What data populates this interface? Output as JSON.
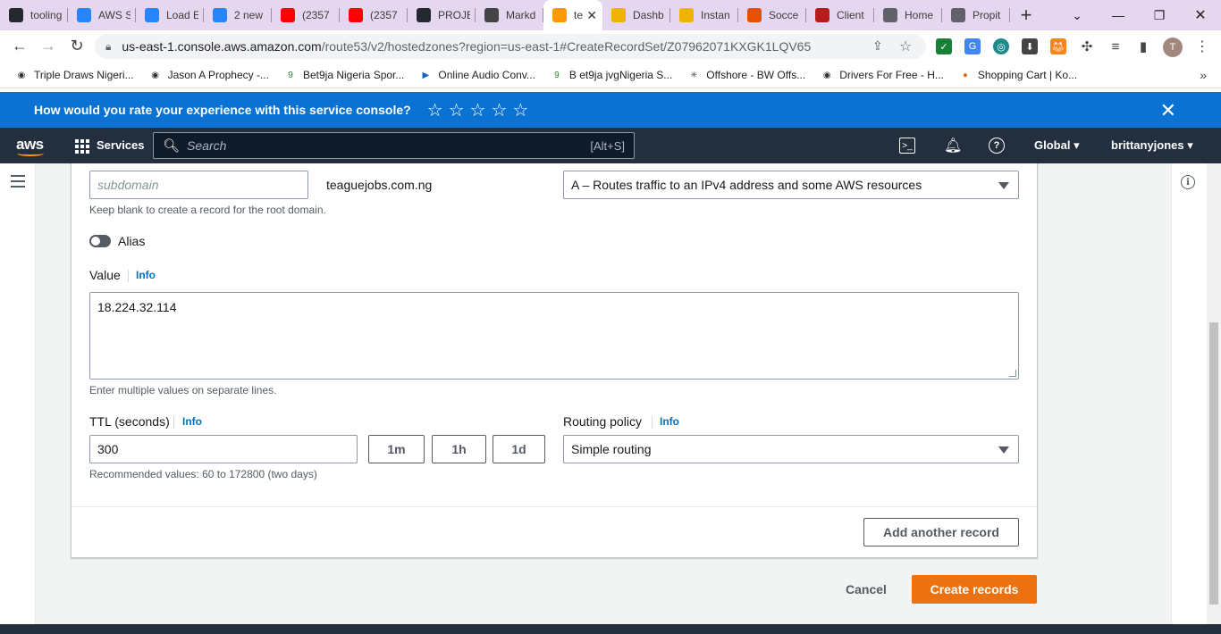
{
  "browser": {
    "tabs": [
      {
        "label": "tooling",
        "icon": "github-icon",
        "color": "#24292f"
      },
      {
        "label": "AWS S",
        "icon": "jira-icon",
        "color": "#2684ff"
      },
      {
        "label": "Load E",
        "icon": "jira-icon",
        "color": "#2684ff"
      },
      {
        "label": "2 new",
        "icon": "jira-icon",
        "color": "#2684ff"
      },
      {
        "label": "(2357",
        "icon": "youtube-icon",
        "color": "#ff0000"
      },
      {
        "label": "(2357",
        "icon": "youtube-icon",
        "color": "#ff0000"
      },
      {
        "label": "PROJE",
        "icon": "github-icon",
        "color": "#24292f"
      },
      {
        "label": "Markd",
        "icon": "markdown-icon",
        "color": "#444444"
      },
      {
        "label": "te",
        "icon": "aws-cube-icon",
        "color": "#ff9900",
        "active": true
      },
      {
        "label": "Dashb",
        "icon": "aws-box-icon",
        "color": "#f0b400"
      },
      {
        "label": "Instan",
        "icon": "aws-box-icon",
        "color": "#f0b400"
      },
      {
        "label": "Socce",
        "icon": "ls-icon",
        "color": "#e65100"
      },
      {
        "label": "Client",
        "icon": "crown-icon",
        "color": "#b71c1c"
      },
      {
        "label": "Home",
        "icon": "globe-icon",
        "color": "#5f6368"
      },
      {
        "label": "Propit",
        "icon": "globe-icon",
        "color": "#5f6368"
      }
    ],
    "url_host": "us-east-1.console.aws.amazon.com",
    "url_path": "/route53/v2/hostedzones?region=us-east-1#CreateRecordSet/Z07962071KXGK1LQV65",
    "profile_initial": "T",
    "bookmarks": [
      {
        "label": "Triple Draws Nigeri...",
        "icon": "globe-icon"
      },
      {
        "label": "Jason A Prophecy -...",
        "icon": "globe-icon"
      },
      {
        "label": "Bet9ja Nigeria Spor...",
        "icon": "bet9ja-icon"
      },
      {
        "label": "Online Audio Conv...",
        "icon": "play-icon"
      },
      {
        "label": "B et9ja jvgNigeria S...",
        "icon": "bet9ja-icon"
      },
      {
        "label": "Offshore - BW Offs...",
        "icon": "asterisk-icon"
      },
      {
        "label": "Drivers For Free - H...",
        "icon": "globe-icon"
      },
      {
        "label": "Shopping Cart | Ko...",
        "icon": "cookie-icon"
      }
    ]
  },
  "feedback": {
    "question": "How would you rate your experience with this service console?",
    "stars": [
      "☆",
      "☆",
      "☆",
      "☆",
      "☆"
    ]
  },
  "aws_nav": {
    "logo": "aws",
    "services_label": "Services",
    "search_placeholder": "Search",
    "search_shortcut": "[Alt+S]",
    "region": "Global",
    "account": "brittanyjones"
  },
  "form": {
    "record_name_placeholder": "subdomain",
    "domain_suffix": "teaguejobs.com.ng",
    "record_name_hint": "Keep blank to create a record for the root domain.",
    "record_type": "A – Routes traffic to an IPv4 address and some AWS resources",
    "alias_label": "Alias",
    "alias_enabled": false,
    "value_label": "Value",
    "info_label": "Info",
    "value": "18.224.32.114",
    "value_hint": "Enter multiple values on separate lines.",
    "ttl_label": "TTL (seconds)",
    "ttl_value": "300",
    "ttl_presets": [
      "1m",
      "1h",
      "1d"
    ],
    "ttl_hint": "Recommended values: 60 to 172800 (two days)",
    "routing_label": "Routing policy",
    "routing_value": "Simple routing",
    "add_another_label": "Add another record"
  },
  "actions": {
    "cancel_label": "Cancel",
    "create_label": "Create records"
  },
  "colors": {
    "banner_blue": "#0972d3",
    "nav_dark": "#232f3e",
    "primary_orange": "#ec7211",
    "link_blue": "#0073bb"
  }
}
